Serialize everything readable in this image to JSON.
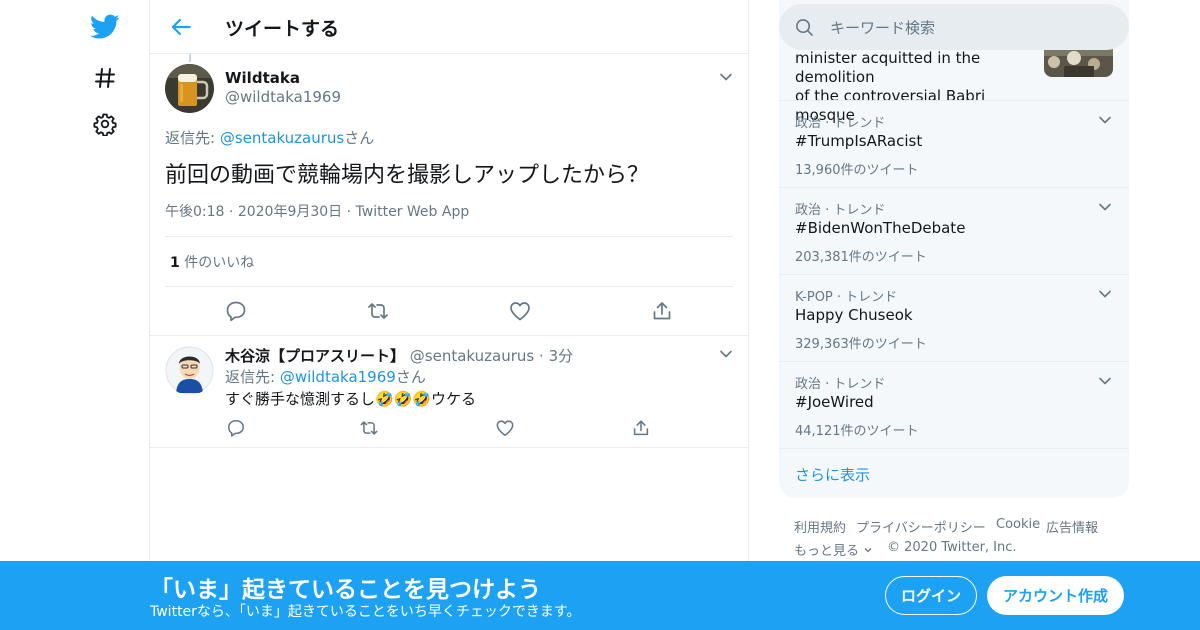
{
  "header": {
    "title": "ツイートする"
  },
  "tweet": {
    "author_name": "Wildtaka",
    "author_handle": "@wildtaka1969",
    "reply_prefix": "返信先: ",
    "reply_to": "@sentakuzaurus",
    "reply_suffix": "さん",
    "text": "前回の動画で競輪場内を撮影しアップしたから？",
    "time": "午後0:18",
    "date": "2020年9月30日",
    "source": "Twitter Web App",
    "dot": "·",
    "likes_count": "1",
    "likes_label": "件のいいね"
  },
  "reply": {
    "author_name": "木谷涼【プロアスリート】",
    "author_handle": "@sentakuzaurus",
    "dot": "·",
    "time_ago": "3分",
    "reply_prefix": "返信先: ",
    "reply_to": "@wildtaka1969",
    "reply_suffix": "さん",
    "text": "すぐ勝手な憶測するし🤣🤣🤣ウケる"
  },
  "search": {
    "placeholder": "キーワード検索"
  },
  "news": {
    "line1": "minister acquitted in the demolition",
    "line2": "of the controversial Babri mosque"
  },
  "trends": [
    {
      "category": "政治 · トレンド",
      "name": "#TrumpIsARacist",
      "count": "13,960件のツイート"
    },
    {
      "category": "政治 · トレンド",
      "name": "#BidenWonTheDebate",
      "count": "203,381件のツイート"
    },
    {
      "category": "K-POP · トレンド",
      "name": "Happy Chuseok",
      "count": "329,363件のツイート"
    },
    {
      "category": "政治 · トレンド",
      "name": "#JoeWired",
      "count": "44,121件のツイート"
    }
  ],
  "show_more": "さらに表示",
  "footer": {
    "terms": "利用規約",
    "privacy": "プライバシーポリシー",
    "cookie": "Cookie",
    "ads": "広告情報",
    "more": "もっと見る",
    "copyright": "© 2020 Twitter, Inc."
  },
  "banner": {
    "title": "「いま」起きていることを見つけよう",
    "subtitle": "Twitterなら、「いま」起きていることをいち早くチェックできます。",
    "login": "ログイン",
    "signup": "アカウント作成"
  },
  "colors": {
    "accent": "#1da1f2",
    "link": "#1b95e0",
    "muted": "#657786"
  }
}
